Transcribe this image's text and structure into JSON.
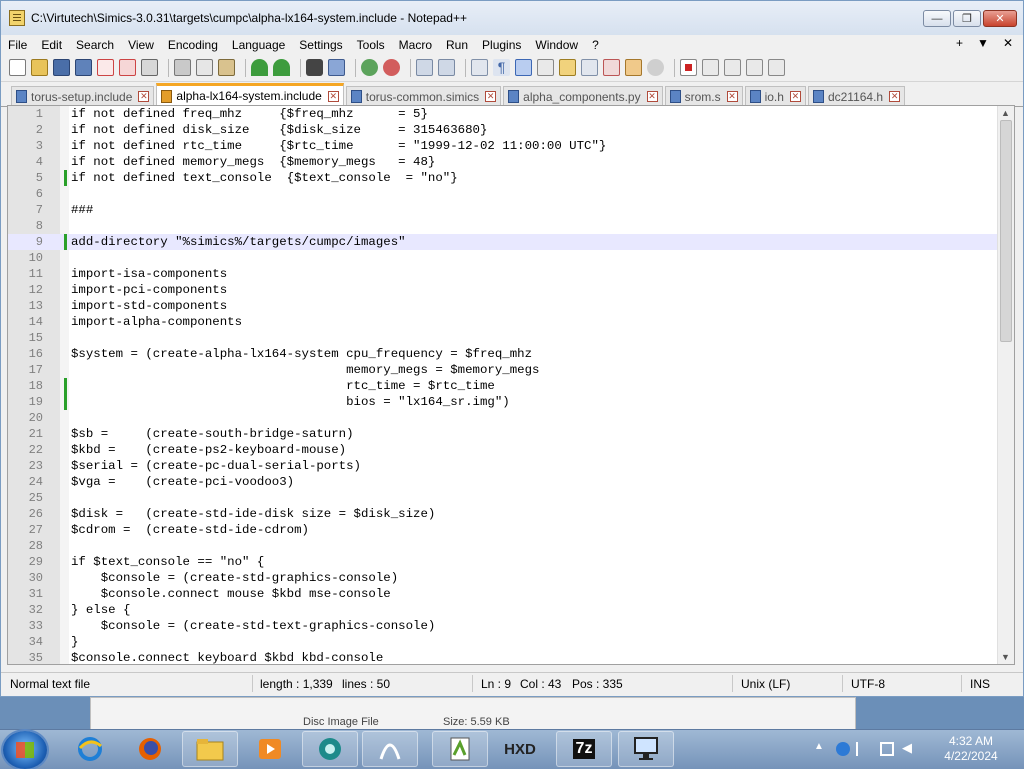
{
  "window": {
    "title": "C:\\Virtutech\\Simics-3.0.31\\targets\\cumpc\\alpha-lx164-system.include - Notepad++",
    "min_label": "—",
    "max_label": "❐",
    "close_label": "✕"
  },
  "menu": {
    "items": [
      "File",
      "Edit",
      "Search",
      "View",
      "Encoding",
      "Language",
      "Settings",
      "Tools",
      "Macro",
      "Run",
      "Plugins",
      "Window",
      "?"
    ],
    "right": [
      "+",
      "▼",
      "✕"
    ]
  },
  "tabs": [
    {
      "label": "torus-setup.include",
      "active": false
    },
    {
      "label": "alpha-lx164-system.include",
      "active": true
    },
    {
      "label": "torus-common.simics",
      "active": false
    },
    {
      "label": "alpha_components.py",
      "active": false
    },
    {
      "label": "srom.s",
      "active": false
    },
    {
      "label": "io.h",
      "active": false
    },
    {
      "label": "dc21164.h",
      "active": false
    }
  ],
  "editor": {
    "lines": [
      {
        "n": "1",
        "text": "if not defined freq_mhz     {$freq_mhz      = 5}",
        "mark": false
      },
      {
        "n": "2",
        "text": "if not defined disk_size    {$disk_size     = 315463680}",
        "mark": false
      },
      {
        "n": "3",
        "text": "if not defined rtc_time     {$rtc_time      = \"1999-12-02 11:00:00 UTC\"}",
        "mark": false
      },
      {
        "n": "4",
        "text": "if not defined memory_megs  {$memory_megs   = 48}",
        "mark": false
      },
      {
        "n": "5",
        "text": "if not defined text_console  {$text_console  = \"no\"}",
        "mark": true
      },
      {
        "n": "6",
        "text": "",
        "mark": false
      },
      {
        "n": "7",
        "text": "###",
        "mark": false
      },
      {
        "n": "8",
        "text": "",
        "mark": false
      },
      {
        "n": "9",
        "text": "add-directory \"%simics%/targets/cumpc/images\"",
        "mark": true,
        "current": true
      },
      {
        "n": "10",
        "text": "",
        "mark": false
      },
      {
        "n": "11",
        "text": "import-isa-components",
        "mark": false
      },
      {
        "n": "12",
        "text": "import-pci-components",
        "mark": false
      },
      {
        "n": "13",
        "text": "import-std-components",
        "mark": false
      },
      {
        "n": "14",
        "text": "import-alpha-components",
        "mark": false
      },
      {
        "n": "15",
        "text": "",
        "mark": false
      },
      {
        "n": "16",
        "text": "$system = (create-alpha-lx164-system cpu_frequency = $freq_mhz",
        "mark": false
      },
      {
        "n": "17",
        "text": "                                     memory_megs = $memory_megs",
        "mark": false
      },
      {
        "n": "18",
        "text": "                                     rtc_time = $rtc_time",
        "mark": true
      },
      {
        "n": "19",
        "text": "                                     bios = \"lx164_sr.img\")",
        "mark": true
      },
      {
        "n": "20",
        "text": "",
        "mark": false
      },
      {
        "n": "21",
        "text": "$sb =     (create-south-bridge-saturn)",
        "mark": false
      },
      {
        "n": "22",
        "text": "$kbd =    (create-ps2-keyboard-mouse)",
        "mark": false
      },
      {
        "n": "23",
        "text": "$serial = (create-pc-dual-serial-ports)",
        "mark": false
      },
      {
        "n": "24",
        "text": "$vga =    (create-pci-voodoo3)",
        "mark": false
      },
      {
        "n": "25",
        "text": "",
        "mark": false
      },
      {
        "n": "26",
        "text": "$disk =   (create-std-ide-disk size = $disk_size)",
        "mark": false
      },
      {
        "n": "27",
        "text": "$cdrom =  (create-std-ide-cdrom)",
        "mark": false
      },
      {
        "n": "28",
        "text": "",
        "mark": false
      },
      {
        "n": "29",
        "text": "if $text_console == \"no\" {",
        "mark": false
      },
      {
        "n": "30",
        "text": "    $console = (create-std-graphics-console)",
        "mark": false
      },
      {
        "n": "31",
        "text": "    $console.connect mouse $kbd mse-console",
        "mark": false
      },
      {
        "n": "32",
        "text": "} else {",
        "mark": false
      },
      {
        "n": "33",
        "text": "    $console = (create-std-text-graphics-console)",
        "mark": false
      },
      {
        "n": "34",
        "text": "}",
        "mark": false
      },
      {
        "n": "35",
        "text": "$console.connect keyboard $kbd kbd-console",
        "mark": false
      }
    ]
  },
  "status": {
    "type": "Normal text file",
    "length": "length : 1,339",
    "lines": "lines : 50",
    "ln": "Ln : 9",
    "col": "Col : 43",
    "pos": "Pos : 335",
    "eol": "Unix (LF)",
    "encoding": "UTF-8",
    "mode": "INS"
  },
  "behind": {
    "col1": "Disc Image File",
    "col2": "Size: 5.59 KB"
  },
  "taskbar": {
    "apps": [
      "internet-explorer",
      "firefox",
      "file-explorer",
      "media-player",
      "app-5",
      "app-6",
      "notepad-plus-plus",
      "hxd-hex-editor",
      "7zip",
      "remote-desktop"
    ],
    "hxd_label": "HXD",
    "sevenzip_label": "7z",
    "time": "4:32 AM",
    "date": "4/22/2024"
  },
  "colors": {
    "accent_tab": "#f5a623",
    "change_mark": "#2aa02a",
    "current_line": "#e8e8ff"
  }
}
